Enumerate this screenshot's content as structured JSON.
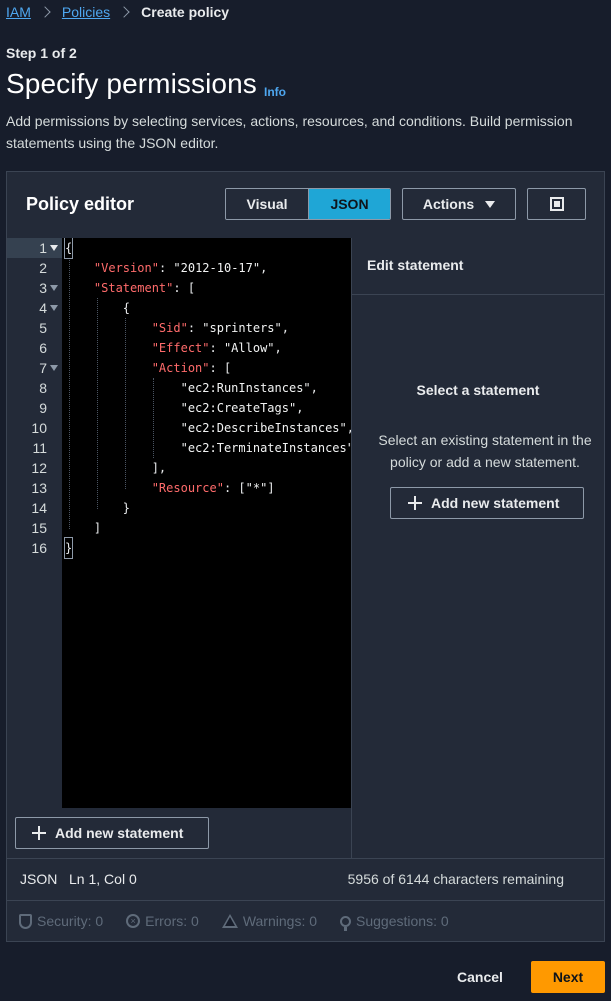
{
  "breadcrumb": {
    "items": [
      "IAM",
      "Policies"
    ],
    "current": "Create policy"
  },
  "header": {
    "step": "Step 1 of 2",
    "title": "Specify permissions",
    "info": "Info",
    "description": "Add permissions by selecting services, actions, resources, and conditions. Build permission statements using the JSON editor."
  },
  "editor": {
    "title": "Policy editor",
    "tabs": {
      "visual": "Visual",
      "json": "JSON",
      "active": "JSON"
    },
    "actions_label": "Actions",
    "fullscreen_icon": "fullscreen-icon",
    "line_numbers": [
      "1",
      "2",
      "3",
      "4",
      "5",
      "6",
      "7",
      "8",
      "9",
      "10",
      "11",
      "12",
      "13",
      "14",
      "15",
      "16"
    ],
    "code_lines": [
      "{",
      "    \"Version\": \"2012-10-17\",",
      "    \"Statement\": [",
      "        {",
      "            \"Sid\": \"sprinters\",",
      "            \"Effect\": \"Allow\",",
      "            \"Action\": [",
      "                \"ec2:RunInstances\",",
      "                \"ec2:CreateTags\",",
      "                \"ec2:DescribeInstances\",",
      "                \"ec2:TerminateInstances\"",
      "            ],",
      "            \"Resource\": [\"*\"]",
      "        }",
      "    ]",
      "}"
    ],
    "add_statement_label": "Add new statement"
  },
  "side_panel": {
    "title": "Edit statement",
    "empty_title": "Select a statement",
    "empty_description": "Select an existing statement in the policy or add a new statement.",
    "add_statement_label": "Add new statement"
  },
  "status": {
    "mode": "JSON",
    "cursor": "Ln 1, Col 0",
    "chars_remaining": "5956 of 6144 characters remaining"
  },
  "validation": {
    "security": "Security: 0",
    "errors": "Errors: 0",
    "warnings": "Warnings: 0",
    "suggestions": "Suggestions: 0"
  },
  "footer": {
    "cancel": "Cancel",
    "next": "Next"
  },
  "colors": {
    "accent": "#1fa6d6",
    "primary": "#ff9900",
    "key": "#ff6b6b",
    "link": "#4ea7f0"
  }
}
